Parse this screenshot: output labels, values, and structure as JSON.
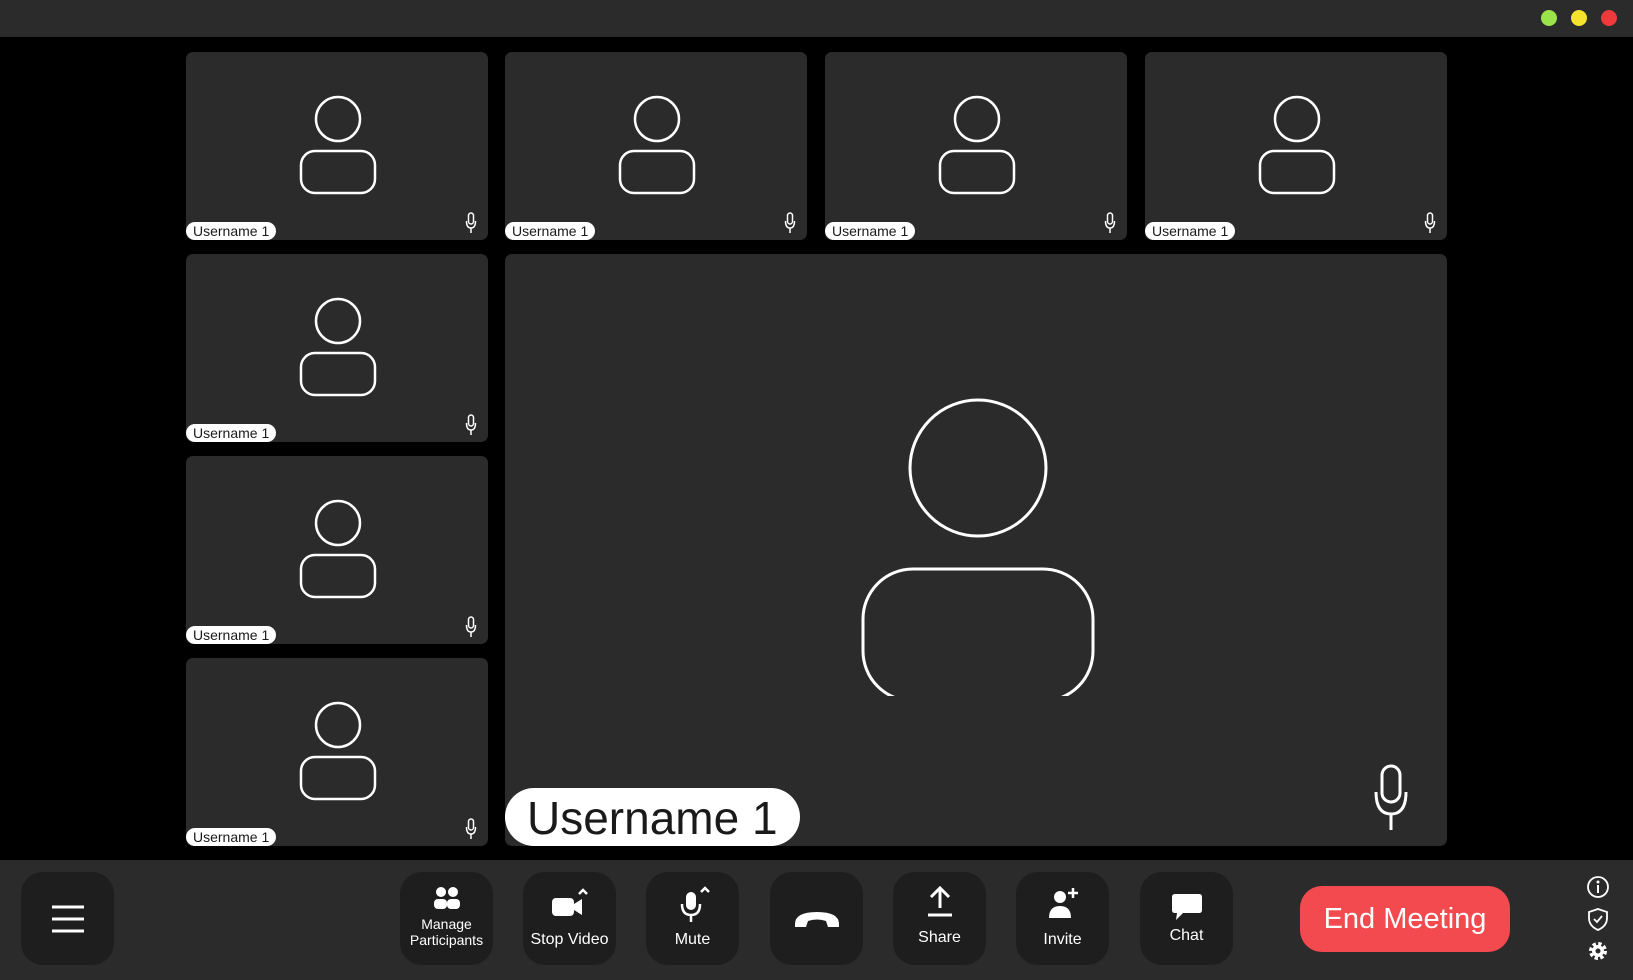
{
  "window": {
    "controls": [
      {
        "name": "maximize",
        "color": "#9be34a"
      },
      {
        "name": "minimize",
        "color": "#f5e22c"
      },
      {
        "name": "close",
        "color": "#ee3a3a"
      }
    ]
  },
  "participants": [
    {
      "username": "Username 1"
    },
    {
      "username": "Username 1"
    },
    {
      "username": "Username 1"
    },
    {
      "username": "Username 1"
    },
    {
      "username": "Username 1"
    },
    {
      "username": "Username 1"
    },
    {
      "username": "Username 1"
    }
  ],
  "active_speaker": {
    "username": "Username 1"
  },
  "toolbar": {
    "menu_icon": "hamburger-icon",
    "manage_participants": {
      "line1": "Manage",
      "line2": "Participants",
      "icon": "participants-icon"
    },
    "stop_video": {
      "label": "Stop Video",
      "icon": "video-camera-icon"
    },
    "mute": {
      "label": "Mute",
      "icon": "microphone-icon"
    },
    "hang_up": {
      "icon": "phone-hangup-icon"
    },
    "share": {
      "label": "Share",
      "icon": "upload-icon"
    },
    "invite": {
      "label": "Invite",
      "icon": "add-user-icon"
    },
    "chat": {
      "label": "Chat",
      "icon": "chat-bubble-icon"
    },
    "end_meeting": {
      "label": "End Meeting",
      "color": "#f24a4e"
    }
  },
  "side_icons": [
    "info-icon",
    "shield-icon",
    "gear-icon"
  ]
}
